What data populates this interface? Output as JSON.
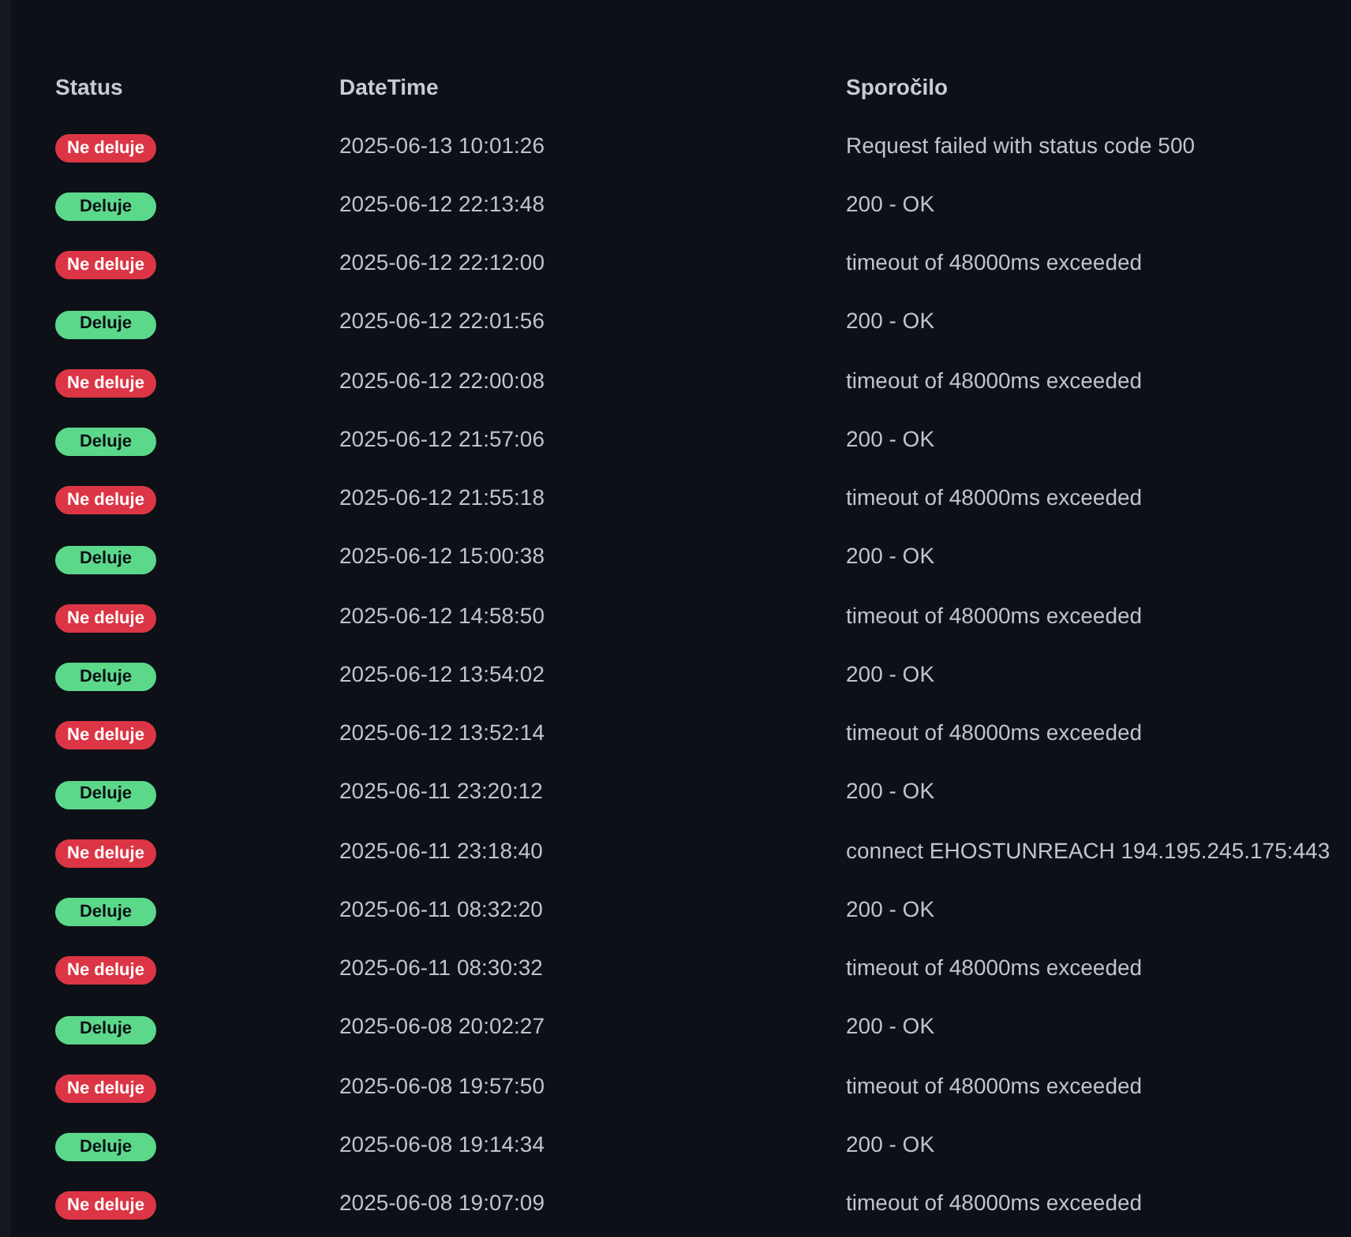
{
  "table": {
    "columns": [
      "Status",
      "DateTime",
      "Sporočilo"
    ],
    "rows": [
      {
        "status": {
          "label": "Ne deluje",
          "kind": "fail"
        },
        "datetime": "2025-06-13 10:01:26",
        "message": "Request failed with status code 500"
      },
      {
        "status": {
          "label": "Deluje",
          "kind": "ok"
        },
        "datetime": "2025-06-12 22:13:48",
        "message": "200 - OK"
      },
      {
        "status": {
          "label": "Ne deluje",
          "kind": "fail"
        },
        "datetime": "2025-06-12 22:12:00",
        "message": "timeout of 48000ms exceeded"
      },
      {
        "status": {
          "label": "Deluje",
          "kind": "ok"
        },
        "datetime": "2025-06-12 22:01:56",
        "message": "200 - OK"
      },
      {
        "status": {
          "label": "Ne deluje",
          "kind": "fail"
        },
        "datetime": "2025-06-12 22:00:08",
        "message": "timeout of 48000ms exceeded"
      },
      {
        "status": {
          "label": "Deluje",
          "kind": "ok"
        },
        "datetime": "2025-06-12 21:57:06",
        "message": "200 - OK"
      },
      {
        "status": {
          "label": "Ne deluje",
          "kind": "fail"
        },
        "datetime": "2025-06-12 21:55:18",
        "message": "timeout of 48000ms exceeded"
      },
      {
        "status": {
          "label": "Deluje",
          "kind": "ok"
        },
        "datetime": "2025-06-12 15:00:38",
        "message": "200 - OK"
      },
      {
        "status": {
          "label": "Ne deluje",
          "kind": "fail"
        },
        "datetime": "2025-06-12 14:58:50",
        "message": "timeout of 48000ms exceeded"
      },
      {
        "status": {
          "label": "Deluje",
          "kind": "ok"
        },
        "datetime": "2025-06-12 13:54:02",
        "message": "200 - OK"
      },
      {
        "status": {
          "label": "Ne deluje",
          "kind": "fail"
        },
        "datetime": "2025-06-12 13:52:14",
        "message": "timeout of 48000ms exceeded"
      },
      {
        "status": {
          "label": "Deluje",
          "kind": "ok"
        },
        "datetime": "2025-06-11 23:20:12",
        "message": "200 - OK"
      },
      {
        "status": {
          "label": "Ne deluje",
          "kind": "fail"
        },
        "datetime": "2025-06-11 23:18:40",
        "message": "connect EHOSTUNREACH 194.195.245.175:443"
      },
      {
        "status": {
          "label": "Deluje",
          "kind": "ok"
        },
        "datetime": "2025-06-11 08:32:20",
        "message": "200 - OK"
      },
      {
        "status": {
          "label": "Ne deluje",
          "kind": "fail"
        },
        "datetime": "2025-06-11 08:30:32",
        "message": "timeout of 48000ms exceeded"
      },
      {
        "status": {
          "label": "Deluje",
          "kind": "ok"
        },
        "datetime": "2025-06-08 20:02:27",
        "message": "200 - OK"
      },
      {
        "status": {
          "label": "Ne deluje",
          "kind": "fail"
        },
        "datetime": "2025-06-08 19:57:50",
        "message": "timeout of 48000ms exceeded"
      },
      {
        "status": {
          "label": "Deluje",
          "kind": "ok"
        },
        "datetime": "2025-06-08 19:14:34",
        "message": "200 - OK"
      },
      {
        "status": {
          "label": "Ne deluje",
          "kind": "fail"
        },
        "datetime": "2025-06-08 19:07:09",
        "message": "timeout of 48000ms exceeded"
      }
    ]
  }
}
